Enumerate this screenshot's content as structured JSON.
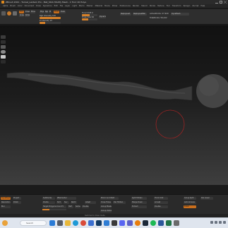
{
  "window": {
    "title": "ZBrush 2021 - Tunnel_Lantern Pro - Ball_Stick Modify Mesh - 1 Tool: 20 Polys"
  },
  "menubar": {
    "items": [
      "Alpha",
      "Brush",
      "Color",
      "Document",
      "Draw",
      "Dynamics",
      "Edit",
      "File",
      "Layer",
      "Light",
      "Macro",
      "Marker",
      "Material",
      "Movie",
      "Picker",
      "Preferences",
      "Render",
      "Stencil",
      "Stroke",
      "Texture",
      "Tool",
      "Transform",
      "Zplugin",
      "Zscript",
      "Help"
    ]
  },
  "shelf": {
    "edit_label": "Edit",
    "draw_label": "Draw",
    "move_label": "Move",
    "scale_label": "Scale",
    "rotate_label": "Rotate",
    "mrgb_label": "Mrgb",
    "rgb_label": "Rgb",
    "m_label": "M",
    "zadd_label": "Zadd",
    "zsub_label": "Zsub",
    "focal_shift_label": "Focal Shift 0",
    "draw_size_label": "Draw Size 64",
    "z_intensity_label": "Z Intensity 25",
    "rgb_intensity_label": "Rgb Intensity 100",
    "dynamic_label": "Dynamic",
    "replay_last_label": "ReplayLast",
    "replay_last_rel_label": "ReplayLastRel",
    "active_points_label": "ActivePoints: 27,940",
    "total_points_label": "TotalPoints: 56,422",
    "dynamesh_label": "DynaMesh",
    "lightbox_label": "LightBox"
  },
  "bottom": {
    "cells": [
      {
        "label": "DynaMesh"
      },
      {
        "label": "Resolution"
      },
      {
        "label": "Blur"
      },
      {
        "label": "Project"
      },
      {
        "label": "Polish"
      },
      {
        "label": "SubDivide"
      },
      {
        "label": "Divide"
      },
      {
        "label": "Smt"
      },
      {
        "label": "Suv"
      },
      {
        "label": "ReUV"
      },
      {
        "label": "ZRemesher"
      },
      {
        "label": "Target Polygons Count 5"
      },
      {
        "label": "Half"
      },
      {
        "label": "Same"
      },
      {
        "label": "Double"
      },
      {
        "label": "Adapt"
      },
      {
        "label": "Mirror And Weld"
      },
      {
        "label": "Close Holes"
      },
      {
        "label": "Del Hidden"
      },
      {
        "label": "Group Masked"
      },
      {
        "label": "Group Visible"
      },
      {
        "label": "Split Hidden"
      },
      {
        "label": "Merge Down"
      },
      {
        "label": "Extract"
      },
      {
        "label": "Thick 0.02"
      },
      {
        "label": "Accept"
      },
      {
        "label": "Double"
      },
      {
        "label": "Group Split"
      },
      {
        "label": "Auto Groups"
      },
      {
        "label": "Polish"
      },
      {
        "label": "Del Lower"
      }
    ],
    "status": "Switched to Draw mode"
  },
  "taskbar": {
    "search_placeholder": "Search"
  },
  "colors": {
    "accent": "#d7812a",
    "panel": "#2e2e2e",
    "cursor_ring": "#b02a2a"
  }
}
